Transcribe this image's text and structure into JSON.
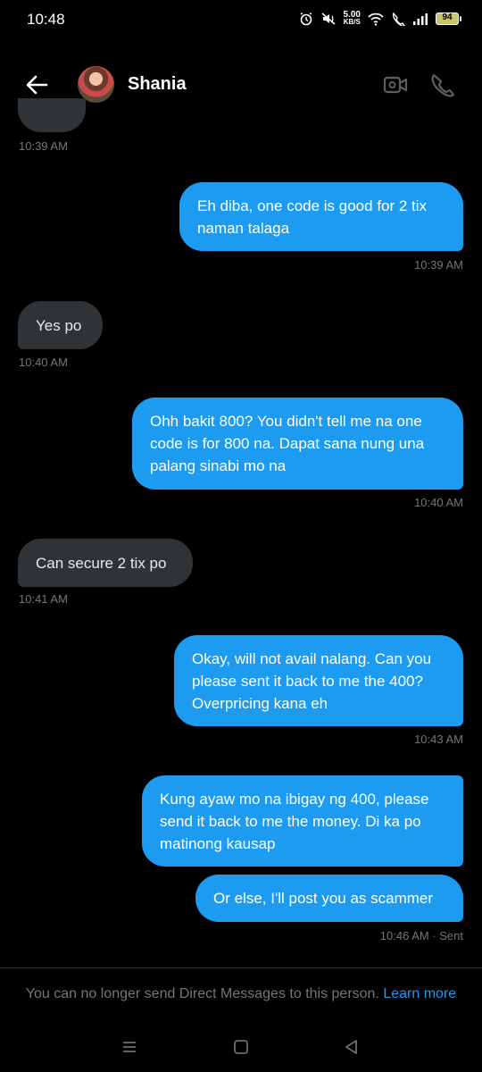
{
  "status_bar": {
    "time": "10:48",
    "net_speed_value": "5.00",
    "net_speed_unit": "KB/S",
    "battery": "94"
  },
  "header": {
    "contact_name": "Shania"
  },
  "messages": [
    {
      "text": "Eh diba, one code is good for  2 tix naman talaga",
      "timestamp": "10:39 AM",
      "direction": "out"
    },
    {
      "text": "Yes po",
      "timestamp": "10:40 AM",
      "direction": "in"
    },
    {
      "text": "Ohh bakit 800? You didn't tell me na one code is for 800 na. Dapat sana nung una palang sinabi mo na",
      "timestamp": "10:40 AM",
      "direction": "out"
    },
    {
      "text": "Can secure 2 tix po",
      "timestamp": "10:41 AM",
      "direction": "in"
    },
    {
      "text": "Okay, will not avail nalang. Can you please sent it back to me the 400? Overpricing kana eh",
      "timestamp": "10:43 AM",
      "direction": "out"
    },
    {
      "text": "Kung ayaw mo na ibigay ng 400, please send it back to me the money. Di ka po matinong kausap",
      "direction": "out"
    },
    {
      "text": "Or else, I'll post you as scammer",
      "timestamp": "10:46 AM · Sent",
      "direction": "out"
    }
  ],
  "earlier_timestamp": "10:39 AM",
  "notice": {
    "text": "You can no longer send Direct Messages to this person.",
    "link": "Learn more"
  },
  "colors": {
    "outgoing_bubble": "#1d9bf0",
    "incoming_bubble": "#2f3336",
    "muted_text": "#71767b"
  }
}
